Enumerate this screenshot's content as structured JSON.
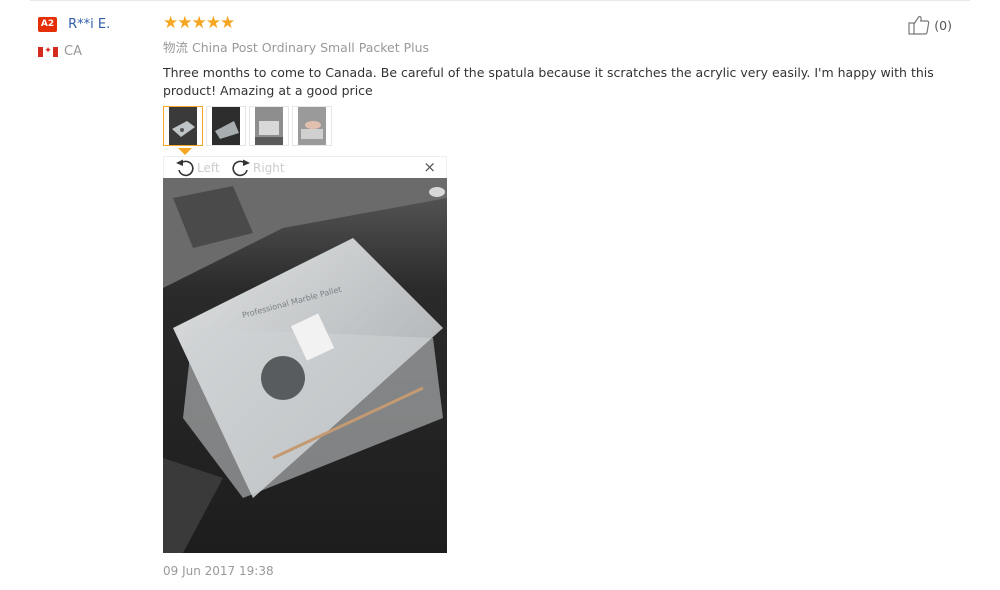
{
  "user": {
    "badge": "A2",
    "name": "R**i E.",
    "country": "CA"
  },
  "review": {
    "stars": "★★★★★",
    "rating": 5,
    "shipping_label": "物流",
    "shipping_method": "China Post Ordinary Small Packet Plus",
    "text": "Three months to come to Canada. Be careful of the spatula because it scratches the acrylic very easily. I'm happy with this product! Amazing at a good price",
    "date": "09 Jun 2017 19:38"
  },
  "helpful": {
    "count": "(0)"
  },
  "viewer": {
    "rotate_left": "Left",
    "rotate_right": "Right",
    "close": "×"
  },
  "colors": {
    "star": "#f5a623",
    "badge": "#e62e04",
    "username": "#2f5eaa"
  }
}
